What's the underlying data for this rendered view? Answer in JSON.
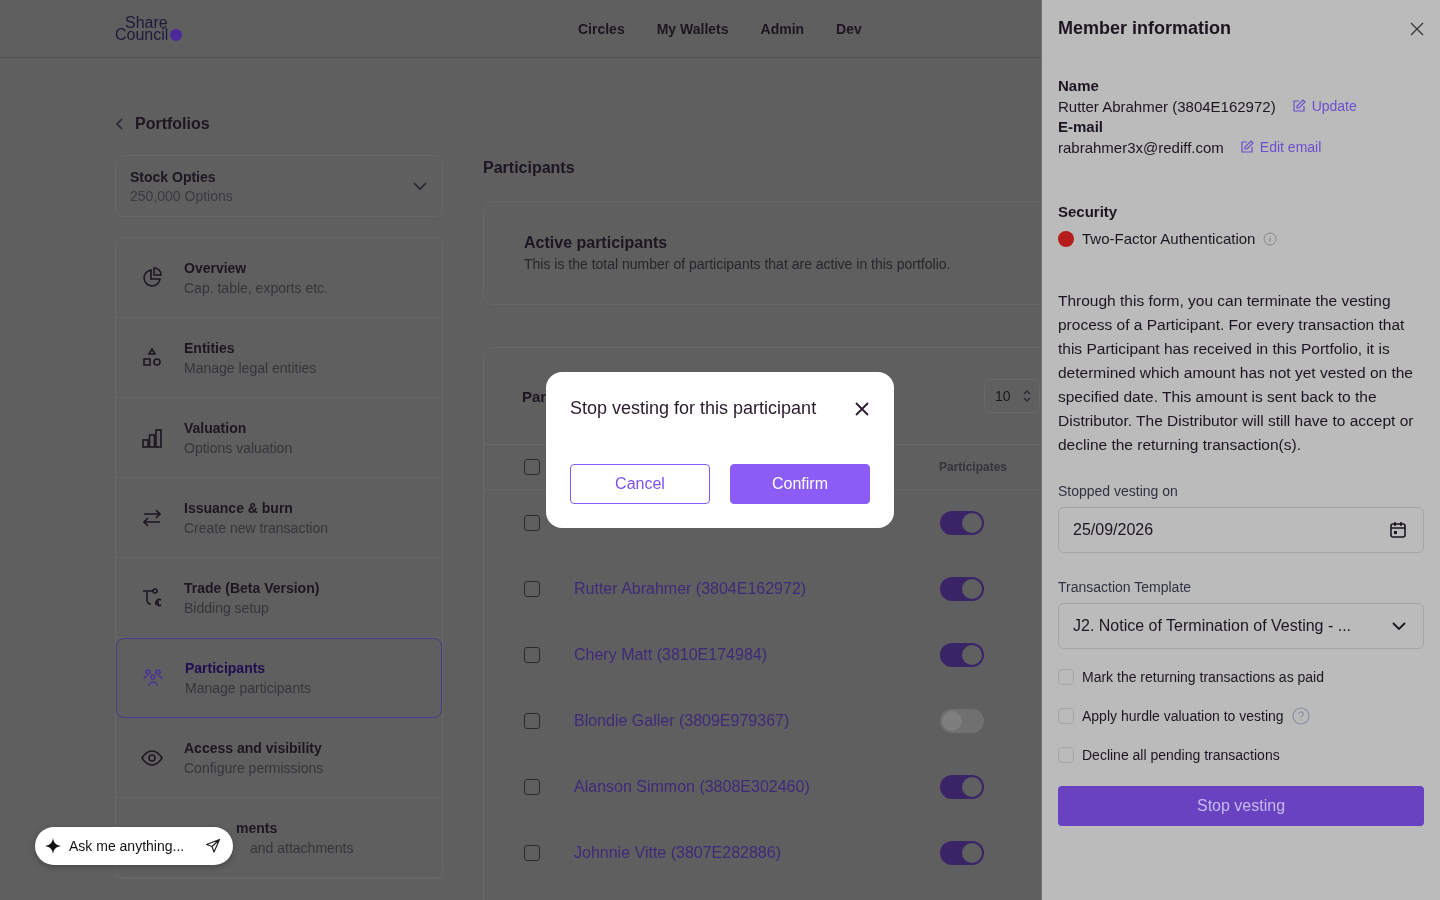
{
  "header": {
    "logo_top": "Share",
    "logo_bottom": "Council",
    "nav": [
      "Circles",
      "My Wallets",
      "Admin",
      "Dev"
    ]
  },
  "back_link": "Portfolios",
  "portfolio_select": {
    "name": "Stock Opties",
    "amount": "250,000 Options"
  },
  "sidebar": {
    "items": [
      {
        "title": "Overview",
        "subtitle": "Cap. table, exports etc.",
        "selected": false
      },
      {
        "title": "Entities",
        "subtitle": "Manage legal entities",
        "selected": false
      },
      {
        "title": "Valuation",
        "subtitle": "Options valuation",
        "selected": false
      },
      {
        "title": "Issuance & burn",
        "subtitle": "Create new transaction",
        "selected": false
      },
      {
        "title": "Trade (Beta Version)",
        "subtitle": "Bidding setup",
        "selected": false
      },
      {
        "title": "Participants",
        "subtitle": "Manage participants",
        "selected": true
      },
      {
        "title": "Access and visibility",
        "subtitle": "Configure permissions",
        "selected": false
      },
      {
        "title": "ments",
        "subtitle": "and attachments",
        "selected": false,
        "kind": "partial"
      }
    ]
  },
  "page_title": "Participants",
  "active_card": {
    "title": "Active participants",
    "description": "This is the total number of participants that are active in this portfolio."
  },
  "table": {
    "title": "Par",
    "page_size": "10",
    "header_checked": false,
    "columns": [
      "Participates"
    ],
    "rows": [
      {
        "checked": false,
        "on": true
      },
      {
        "name": "Rutter Abrahmer (3804E162972)",
        "checked": false,
        "on": true
      },
      {
        "name": "Chery Matt (3810E174984)",
        "checked": false,
        "on": true
      },
      {
        "name": "Blondie Galler (3809E979367)",
        "checked": false,
        "on": false
      },
      {
        "name": "Alanson Simmon (3808E302460)",
        "checked": false,
        "on": true
      },
      {
        "name": "Johnnie Vitte (3807E282886)",
        "checked": false,
        "on": true
      }
    ]
  },
  "ask_box": {
    "placeholder": "Ask me anything..."
  },
  "modal": {
    "title": "Stop vesting for this participant",
    "buttons": [
      {
        "label": "Cancel",
        "kind": "secondary"
      },
      {
        "label": "Confirm",
        "kind": "primary"
      }
    ]
  },
  "drawer": {
    "title": "Member information",
    "name_label": "Name",
    "name": "Rutter Abrahmer (3804E162972)",
    "name_action": "Update",
    "email_label": "E-mail",
    "email": "rabrahmer3x@rediff.com",
    "email_action": "Edit email",
    "security_label": "Security",
    "security_item": {
      "label": "Two-Factor Authentication",
      "color": "#b71c1c"
    },
    "description": "Through this form, you can terminate the vesting process of a Participant. For every transaction that this Participant has received in this Portfolio, it is determined which amount has not yet vested on the specified date. This amount is sent back to the Distributor. The Distributor will still have to accept or decline the returning transaction(s).",
    "date_label": "Stopped vesting on",
    "date_value": "25/09/2026",
    "template_label": "Transaction Template",
    "template_value": "J2. Notice of Termination of Vesting - ...",
    "options": [
      {
        "label": "Mark the returning transactions as paid",
        "checked": false,
        "help": false
      },
      {
        "label": "Apply hurdle valuation to vesting",
        "checked": false,
        "help": true
      },
      {
        "label": "Decline all pending transactions",
        "checked": false,
        "help": false
      }
    ],
    "submit": "Stop vesting"
  }
}
